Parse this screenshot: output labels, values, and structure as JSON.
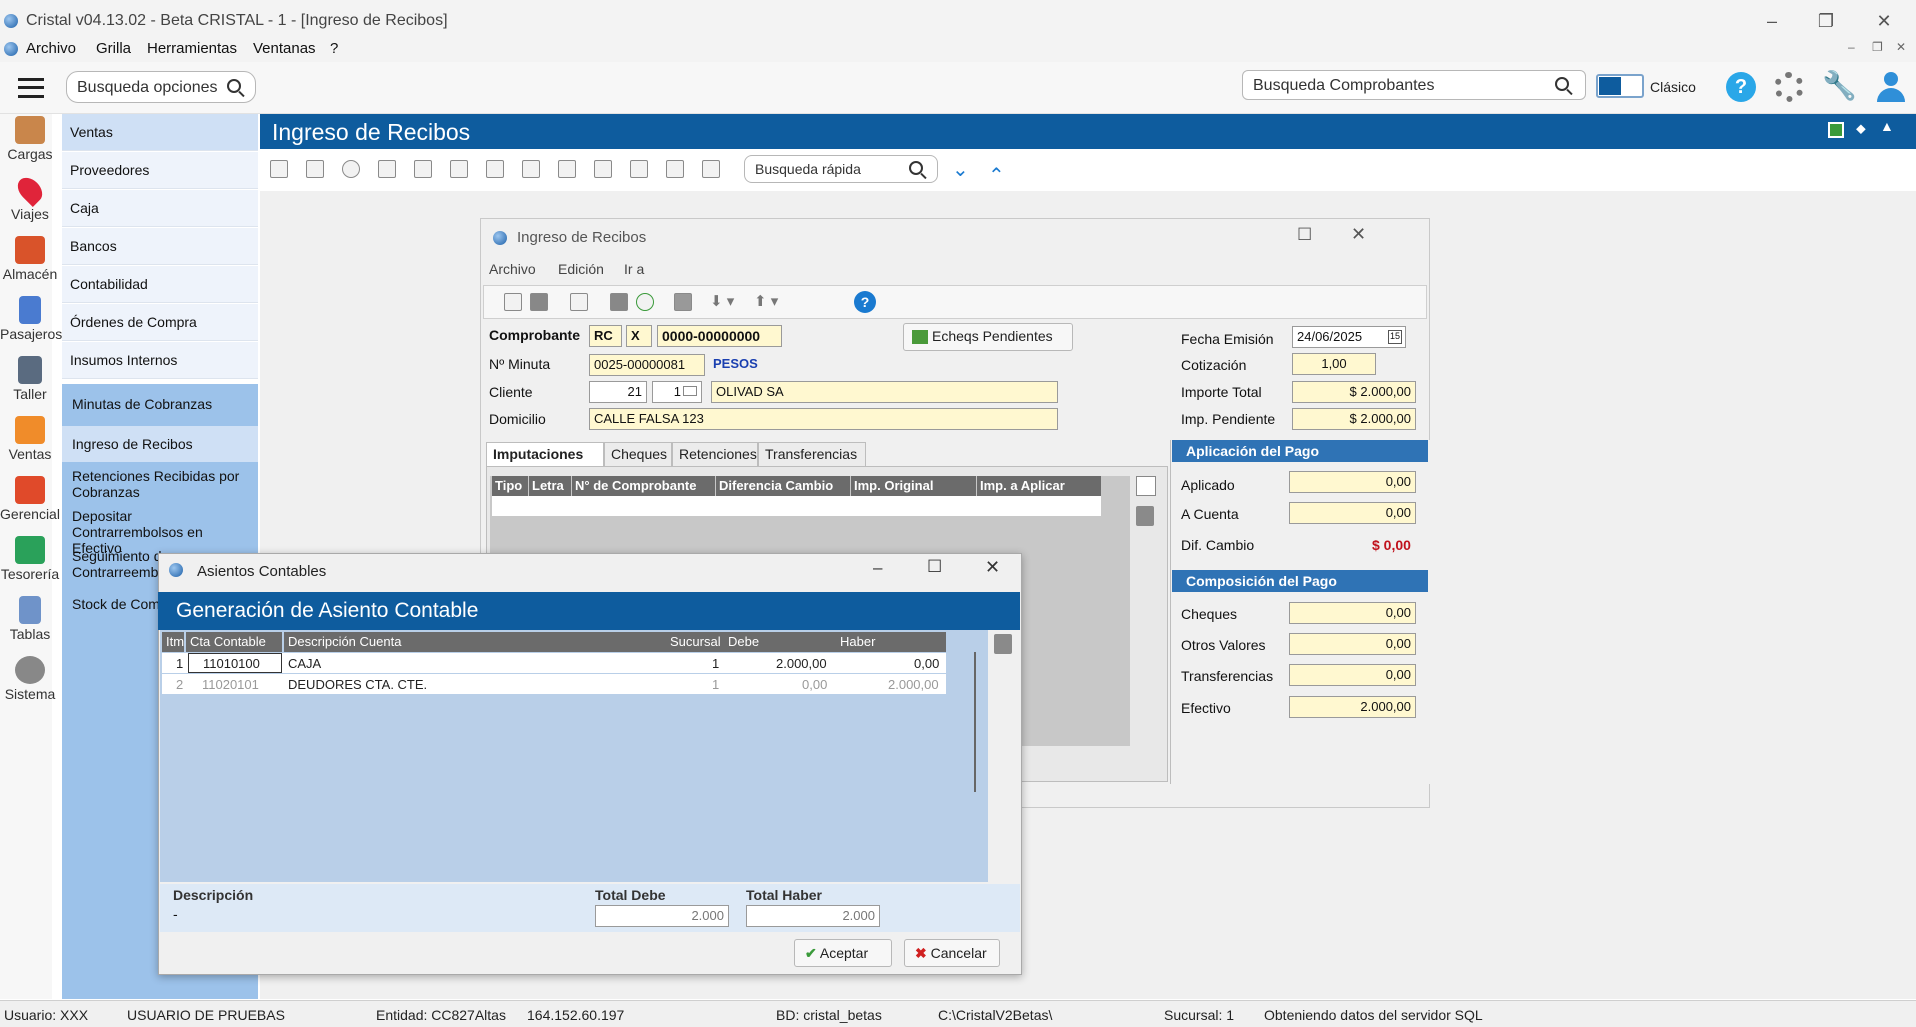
{
  "titlebar": {
    "title": "Cristal v04.13.02 - Beta CRISTAL - 1 - [Ingreso de Recibos]"
  },
  "menubar": [
    "Archivo",
    "Grilla",
    "Herramientas",
    "Ventanas",
    "?"
  ],
  "search": {
    "options_placeholder": "Busqueda opciones",
    "comprobantes_placeholder": "Busqueda Comprobantes",
    "mode_label": "Clásico"
  },
  "rail": [
    "Cargas",
    "Viajes",
    "Almacén",
    "Pasajeros",
    "Taller",
    "Ventas",
    "Gerencial",
    "Tesorería",
    "Tablas",
    "Sistema"
  ],
  "nav": [
    "Ventas",
    "Proveedores",
    "Caja",
    "Bancos",
    "Contabilidad",
    "Órdenes de Compra",
    "Insumos Internos"
  ],
  "subnav": [
    "Minutas de Cobranzas",
    "Ingreso de Recibos",
    "Retenciones Recibidas por Cobranzas",
    "Depositar Contrarrembolsos en Efectivo",
    "Seguimiento de Contrarreembolsos",
    "Stock de Comprobantes"
  ],
  "main": {
    "header": "Ingreso de Recibos",
    "quick_search": "Busqueda rápida"
  },
  "recibos": {
    "window_title": "Ingreso de Recibos",
    "menu": [
      "Archivo",
      "Edición",
      "Ir a"
    ],
    "comprobante_label": "Comprobante",
    "tipo": "RC",
    "letra": "X",
    "numero": "0000-00000000",
    "echeqs_button": "Echeqs Pendientes",
    "minuta_label": "Nº Minuta",
    "minuta": "0025-00000081",
    "moneda": "PESOS",
    "cliente_label": "Cliente",
    "cliente_codigo": "21",
    "cliente_suc": "1",
    "cliente_nombre": "OLIVAD SA",
    "domicilio_label": "Domicilio",
    "domicilio": "CALLE FALSA 123",
    "fecha_label": "Fecha Emisión",
    "fecha": "24/06/2025",
    "cotizacion_label": "Cotización",
    "cotizacion": "1,00",
    "importe_total_label": "Importe Total",
    "importe_total": "$ 2.000,00",
    "imp_pendiente_label": "Imp. Pendiente",
    "imp_pendiente": "$ 2.000,00",
    "tabs": [
      "Imputaciones",
      "Cheques",
      "Retenciones",
      "Transferencias"
    ],
    "grid_headers": [
      "Tipo",
      "Letra",
      "N° de Comprobante",
      "Diferencia Cambio",
      "Imp. Original",
      "Imp. a Aplicar"
    ],
    "aplicacion": {
      "title": "Aplicación del Pago",
      "aplicado_label": "Aplicado",
      "aplicado": "0,00",
      "a_cuenta_label": "A Cuenta",
      "a_cuenta": "0,00",
      "dif_cambio_label": "Dif. Cambio",
      "dif_cambio": "$ 0,00"
    },
    "composicion": {
      "title": "Composición del Pago",
      "cheques_label": "Cheques",
      "cheques": "0,00",
      "otros_label": "Otros Valores",
      "otros": "0,00",
      "transf_label": "Transferencias",
      "transf": "0,00",
      "efectivo_label": "Efectivo",
      "efectivo": "2.000,00"
    }
  },
  "asientos": {
    "window_title": "Asientos Contables",
    "header": "Generación de Asiento Contable",
    "columns": [
      "Itm",
      "Cta Contable",
      "Descripción Cuenta",
      "Sucursal",
      "Debe",
      "Haber"
    ],
    "rows": [
      {
        "itm": "1",
        "cta": "11010100",
        "desc": "CAJA",
        "suc": "1",
        "debe": "2.000,00",
        "haber": "0,00"
      },
      {
        "itm": "2",
        "cta": "11020101",
        "desc": "DEUDORES CTA. CTE.",
        "suc": "1",
        "debe": "0,00",
        "haber": "2.000,00"
      }
    ],
    "descripcion_label": "Descripción",
    "descripcion": "-",
    "total_debe_label": "Total Debe",
    "total_debe": "2.000",
    "total_haber_label": "Total Haber",
    "total_haber": "2.000",
    "aceptar": "Aceptar",
    "cancelar": "Cancelar"
  },
  "status": {
    "usuario": "Usuario: XXX",
    "usuario_nombre": "USUARIO DE PRUEBAS",
    "entidad": "Entidad: CC827Altas",
    "ip": "164.152.60.197",
    "bd": "BD: cristal_betas",
    "path": "C:\\CristalV2Betas\\",
    "sucursal": "Sucursal: 1",
    "mensaje": "Obteniendo datos del servidor SQL"
  }
}
